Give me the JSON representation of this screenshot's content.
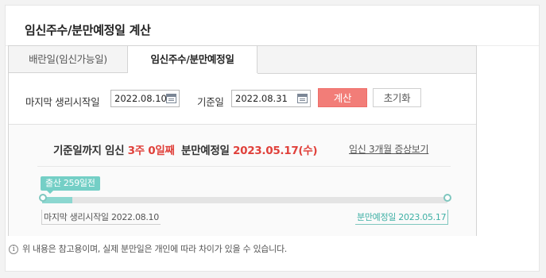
{
  "title": "임신주수/분만예정일 계산",
  "tabs": [
    {
      "label": "배란일(임신가능일)"
    },
    {
      "label": "임신주수/분만예정일"
    }
  ],
  "form": {
    "last_period_label": "마지막 생리시작일",
    "last_period_value": "2022.08.10",
    "base_date_label": "기준일",
    "base_date_value": "2022.08.31",
    "calc_button": "계산",
    "reset_button": "초기화"
  },
  "result": {
    "prefix": "기준일까지 임신",
    "weeks": "3주 0일째",
    "due_label": "분만예정일",
    "due_date": "2023.05.17(수)",
    "symptom_link": "임신 3개월 증상보기"
  },
  "timeline": {
    "badge": "출산 259일전",
    "start_label": "마지막 생리시작일 2022.08.10",
    "end_label": "분만예정일 2023.05.17",
    "progress_fraction": 0.075
  },
  "notice": "위 내용은 참고용이며, 실제 분만일은 개인에 따라 차이가 있을 수 있습니다.",
  "icons": {
    "calendar": "calendar-icon",
    "info": "info-icon"
  },
  "colors": {
    "accent_red": "#e0413b",
    "calc_button": "#f27d78",
    "timeline_teal": "#74cfc6"
  }
}
